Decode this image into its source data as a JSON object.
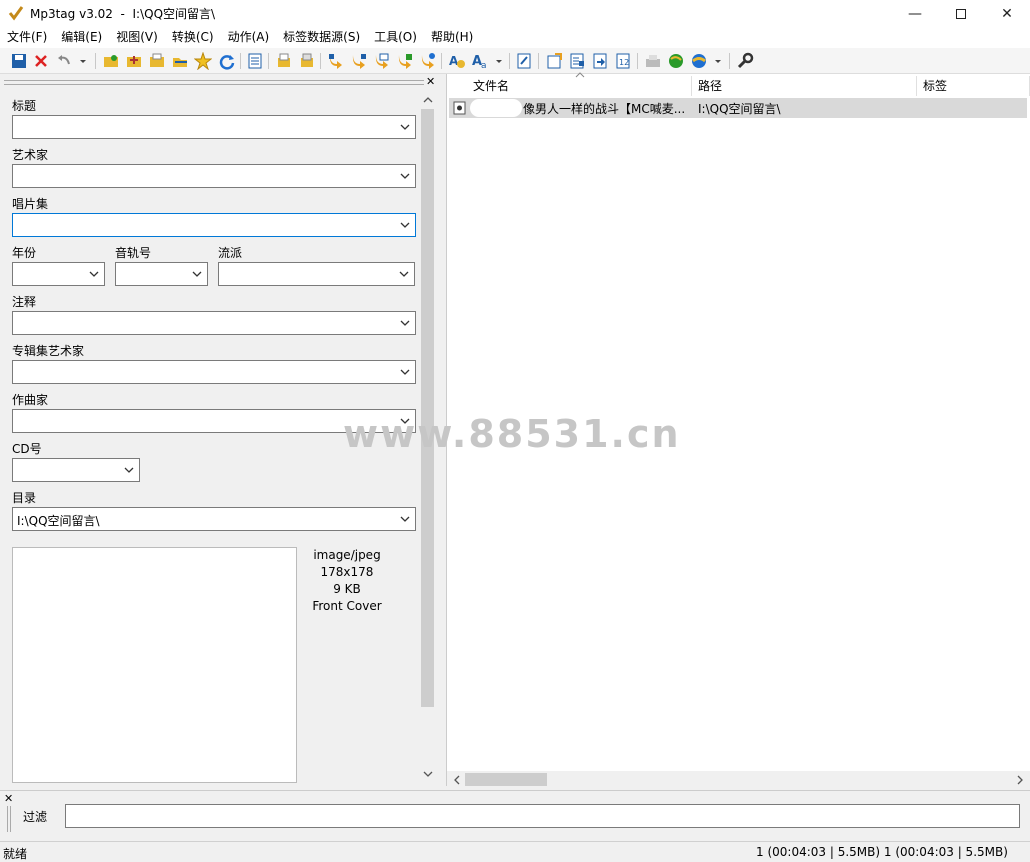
{
  "window": {
    "title": "Mp3tag v3.02  -  I:\\QQ空间留言\\"
  },
  "menu": [
    "文件(F)",
    "编辑(E)",
    "视图(V)",
    "转换(C)",
    "动作(A)",
    "标签数据源(S)",
    "工具(O)",
    "帮助(H)"
  ],
  "fields": {
    "title_label": "标题",
    "artist_label": "艺术家",
    "album_label": "唱片集",
    "year_label": "年份",
    "track_label": "音轨号",
    "genre_label": "流派",
    "comment_label": "注释",
    "album_artist_label": "专辑集艺术家",
    "composer_label": "作曲家",
    "cd_label": "CD号",
    "directory_label": "目录",
    "directory_value": "I:\\QQ空间留言\\"
  },
  "cover": {
    "mime": "image/jpeg",
    "size": "178x178",
    "filesize": "9 KB",
    "type": "Front Cover"
  },
  "file_list": {
    "columns": [
      "文件名",
      "路径",
      "标签"
    ],
    "rows": [
      {
        "filename": "像男人一样的战斗【MC喊麦...",
        "path": "I:\\QQ空间留言\\"
      }
    ]
  },
  "filter": {
    "label": "过滤"
  },
  "status": {
    "left": "就绪",
    "right": "1 (00:04:03 | 5.5MB)  1 (00:04:03 | 5.5MB)"
  },
  "watermark": "www.88531.cn",
  "colors": {
    "accent": "#0078d7",
    "selected_row": "#d9d9d9"
  }
}
